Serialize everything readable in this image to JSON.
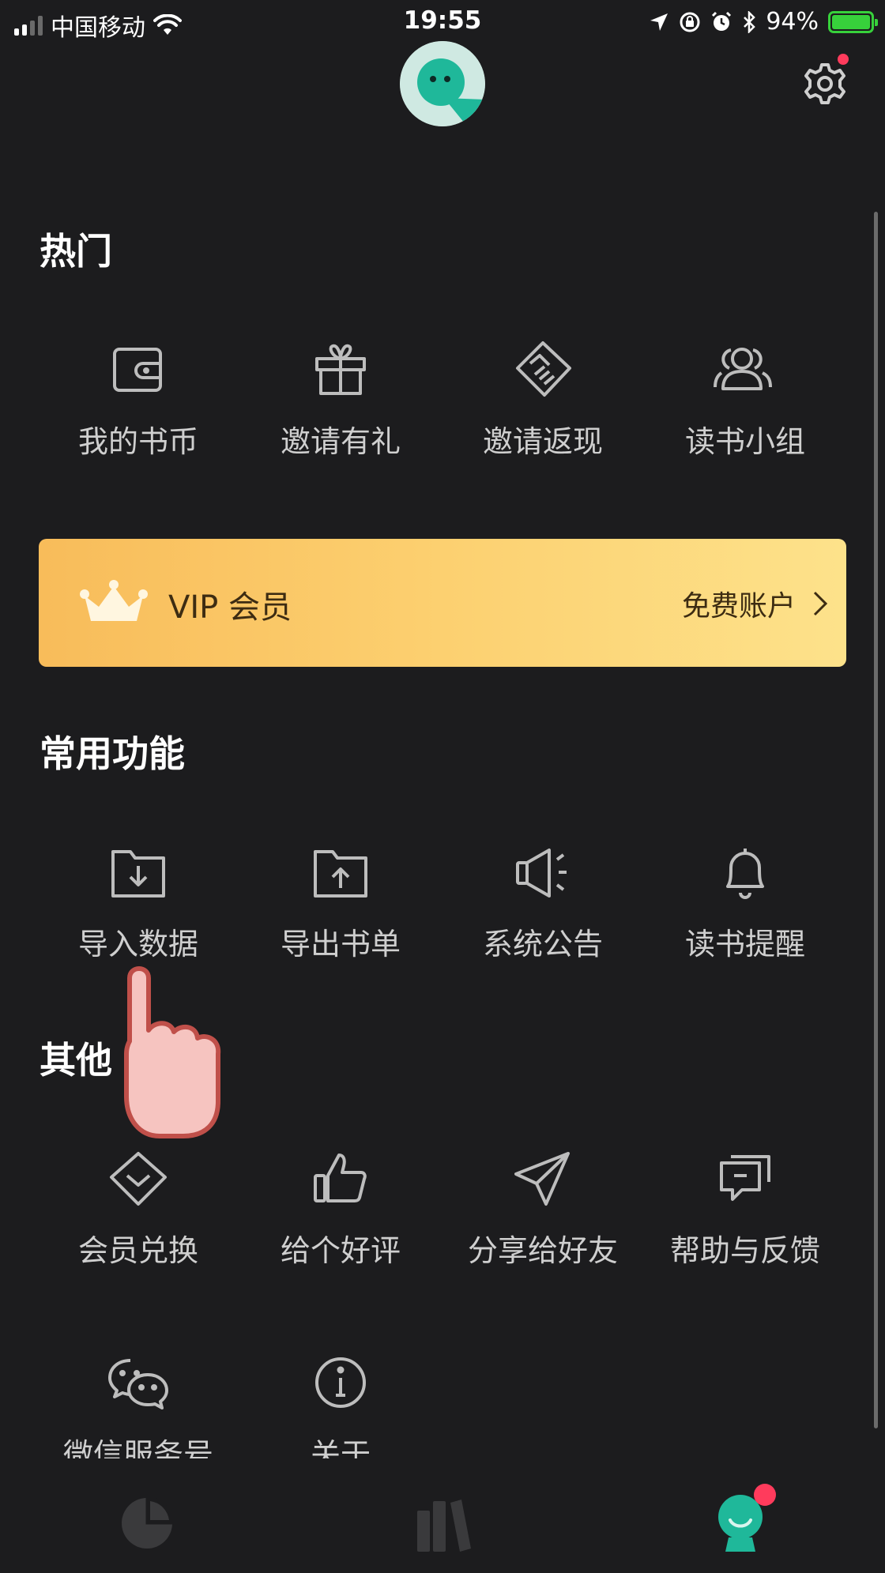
{
  "status_bar": {
    "carrier": "中国移动",
    "time": "19:55",
    "battery": "94%"
  },
  "sections": {
    "hot": {
      "title": "热门",
      "items": [
        "我的书币",
        "邀请有礼",
        "邀请返现",
        "读书小组"
      ]
    },
    "vip": {
      "title": "VIP 会员",
      "account_status": "免费账户"
    },
    "common": {
      "title": "常用功能",
      "items": [
        "导入数据",
        "导出书单",
        "系统公告",
        "读书提醒"
      ]
    },
    "other": {
      "title": "其他",
      "items": [
        "会员兑换",
        "给个好评",
        "分享给好友",
        "帮助与反馈",
        "微信服务号",
        "关于"
      ]
    }
  },
  "icons": {
    "hot": [
      "wallet-icon",
      "gift-icon",
      "handshake-icon",
      "group-icon"
    ],
    "common": [
      "import-folder-icon",
      "export-folder-icon",
      "megaphone-icon",
      "bell-icon"
    ],
    "other": [
      "diamond-icon",
      "thumbs-up-icon",
      "paper-plane-icon",
      "feedback-icon",
      "wechat-icon",
      "info-icon"
    ]
  },
  "colors": {
    "background": "#1c1c1e",
    "vip_gradient_start": "#f8bc5a",
    "vip_gradient_end": "#fde28b",
    "accent_teal": "#1fb89a",
    "badge_red": "#ff3b5c",
    "battery_green": "#37d13b"
  }
}
